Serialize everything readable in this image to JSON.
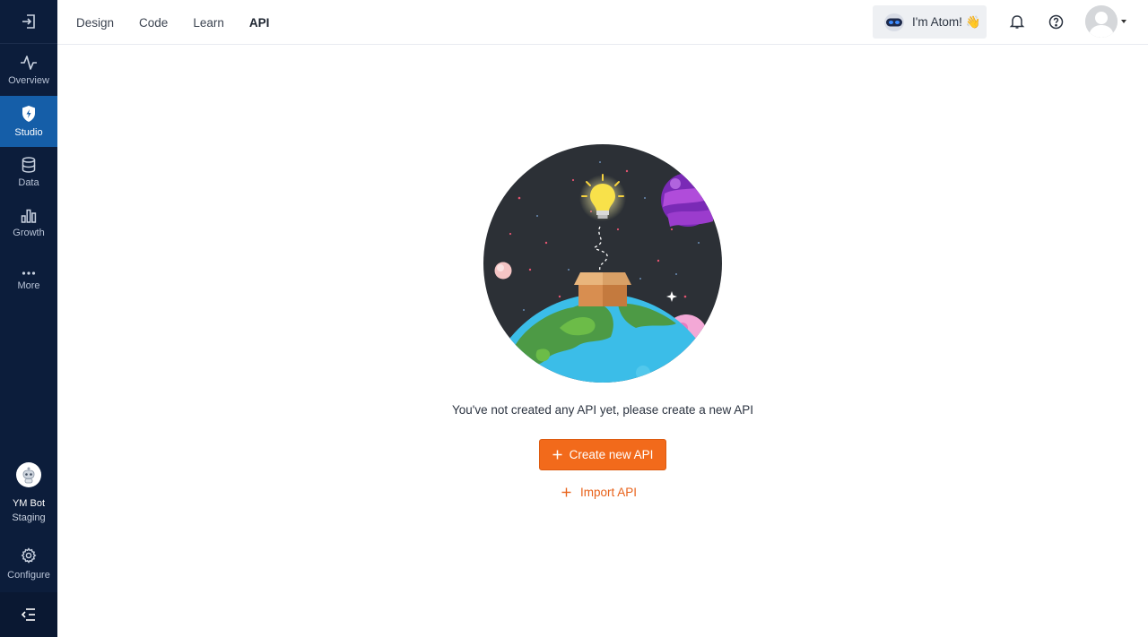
{
  "sidebar": {
    "items": [
      {
        "label": "Overview",
        "icon": "activity-icon"
      },
      {
        "label": "Studio",
        "icon": "shield-bolt-icon",
        "active": true
      },
      {
        "label": "Data",
        "icon": "database-icon"
      },
      {
        "label": "Growth",
        "icon": "bar-chart-icon"
      },
      {
        "label": "More",
        "icon": "ellipsis-icon"
      }
    ],
    "bot": {
      "name": "YM Bot",
      "environment": "Staging"
    },
    "configure_label": "Configure"
  },
  "topbar": {
    "tabs": [
      {
        "label": "Design"
      },
      {
        "label": "Code"
      },
      {
        "label": "Learn"
      },
      {
        "label": "API",
        "active": true
      }
    ],
    "atom_label": "I'm Atom! 👋"
  },
  "main": {
    "empty_message": "You've not created any API yet, please create a new API",
    "create_button": "Create new API",
    "import_button": "Import API"
  },
  "colors": {
    "sidebar_bg": "#0c1d3b",
    "sidebar_active": "#155ea8",
    "accent_orange": "#f26a1b"
  }
}
